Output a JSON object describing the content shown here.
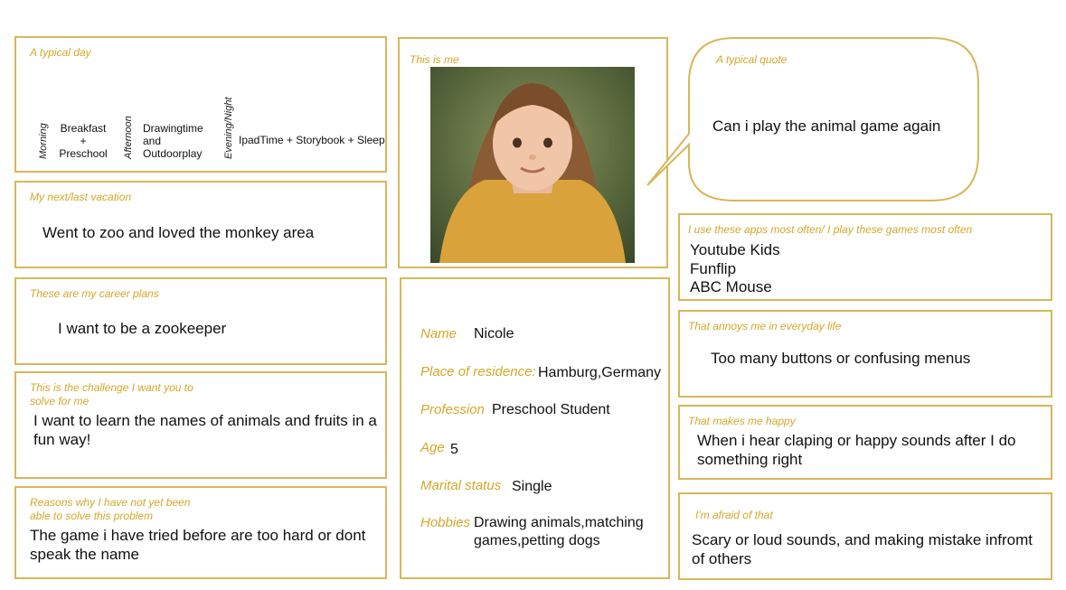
{
  "day": {
    "label": "A typical day",
    "morning_label": "Morning",
    "morning_text": "Breakfast\n+\nPreschool",
    "afternoon_label": "Afternoon",
    "afternoon_text": "Drawingtime\nand\nOutdoorplay",
    "evening_label": "Evening/Night",
    "evening_text": "IpadTime + Storybook + Sleep"
  },
  "vacation": {
    "label": "My next/last vacation",
    "text": "Went to zoo and loved the monkey area"
  },
  "career": {
    "label": "These are my career plans",
    "text": "I want to be a zookeeper"
  },
  "challenge": {
    "label": "This is the challenge I want you to\nsolve for me",
    "text": "I want to learn the names of animals and fruits in a fun way!"
  },
  "reasons": {
    "label": "Reasons why I have not yet been\nable to solve this problem",
    "text": "The game i have tried before are too hard or dont speak the name"
  },
  "me": {
    "label": "This is me"
  },
  "quote": {
    "label": "A typical quote",
    "text": "Can i play the animal game again"
  },
  "apps": {
    "label": "I use these apps most often/ I play these games most often",
    "items": [
      "Youtube Kids",
      "Funflip",
      "ABC Mouse"
    ]
  },
  "annoys": {
    "label": "That annoys me in everyday life",
    "text": "Too many buttons or confusing menus"
  },
  "happy": {
    "label": "That makes me happy",
    "text": "When i hear claping or happy sounds after I do something right"
  },
  "afraid": {
    "label": "I'm afraid of that",
    "text": "Scary or loud sounds, and making mistake infromt of others"
  },
  "profile": {
    "name_label": "Name",
    "name": "Nicole",
    "residence_label": "Place of residence:",
    "residence": "Hamburg,Germany",
    "profession_label": "Profession",
    "profession": "Preschool Student",
    "age_label": "Age",
    "age": "5",
    "marital_label": "Marital status",
    "marital": "Single",
    "hobbies_label": "Hobbies",
    "hobbies": "Drawing animals,matching games,petting dogs"
  },
  "colors": {
    "border": "#d8b75a",
    "label": "#d4a72a"
  }
}
